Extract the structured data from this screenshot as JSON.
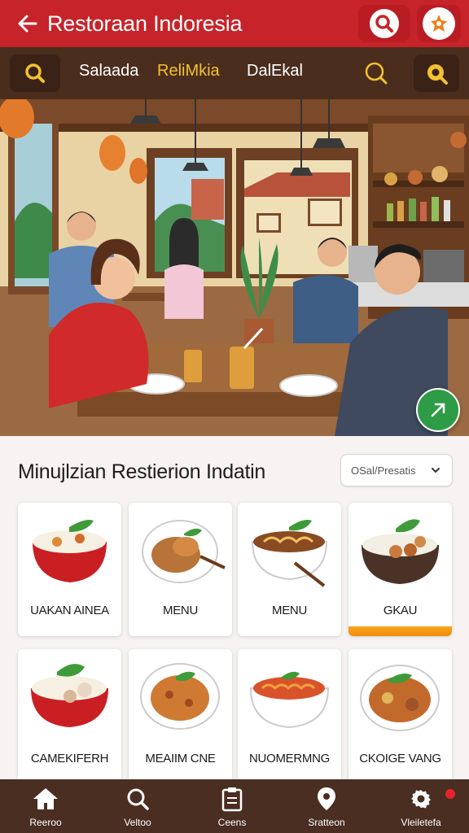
{
  "header": {
    "title": "Restoraan Indoresia",
    "back_icon": "arrow-left-icon",
    "search_icon": "search-icon",
    "badge_icon": "star-badge-icon"
  },
  "subnav": {
    "tabs": [
      {
        "label": "Salaada",
        "active": false
      },
      {
        "label": "ReliMkia",
        "active": true
      },
      {
        "label": "DalEkal",
        "active": false
      }
    ],
    "accent": "#f2c230"
  },
  "section": {
    "title": "Minujlzian Restierion Indatin",
    "sort_label": "OSal/Presatis"
  },
  "menu_cards": [
    {
      "label": "UAKAN AINEA",
      "dish": "rice-bowl",
      "highlight": false
    },
    {
      "label": "MENU",
      "dish": "grilled-plate",
      "highlight": false
    },
    {
      "label": "MENU",
      "dish": "noodle-bowl",
      "highlight": false
    },
    {
      "label": "GKAU",
      "dish": "meatball-bowl",
      "highlight": true
    },
    {
      "label": "CAMEKIFERH",
      "dish": "red-rice-bowl",
      "highlight": false
    },
    {
      "label": "MEAIIM CNE",
      "dish": "curry-plate",
      "highlight": false
    },
    {
      "label": "NUOMERMNG",
      "dish": "spaghetti-bowl",
      "highlight": false
    },
    {
      "label": "CKOIGE VANG",
      "dish": "stir-fry-plate",
      "highlight": false
    }
  ],
  "bottom_nav": [
    {
      "label": "Reeroo",
      "icon": "home-icon"
    },
    {
      "label": "Veltoo",
      "icon": "search-icon"
    },
    {
      "label": "Ceens",
      "icon": "clipboard-icon"
    },
    {
      "label": "Sratteon",
      "icon": "location-pin-icon"
    },
    {
      "label": "Vleiletefa",
      "icon": "gear-icon"
    }
  ],
  "colors": {
    "header": "#c6242a",
    "subnav": "#4a2d1d",
    "bottom_nav": "#4a2e21",
    "fab": "#2e9b46",
    "notification": "#e8232b"
  }
}
